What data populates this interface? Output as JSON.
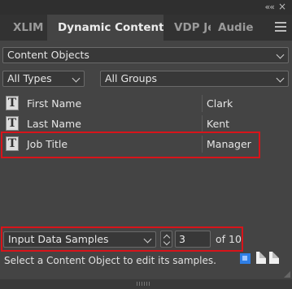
{
  "window": {
    "collapse_glyph": "««",
    "close_glyph": "×"
  },
  "tabs": [
    {
      "label": "XLIM",
      "active": false
    },
    {
      "label": "Dynamic Content",
      "active": true
    },
    {
      "label": "VDP Je",
      "active": false
    },
    {
      "label": "Audie",
      "active": false
    }
  ],
  "content_selector": {
    "value": "Content Objects"
  },
  "type_filter": {
    "value": "All Types"
  },
  "group_filter": {
    "value": "All Groups"
  },
  "content_objects": [
    {
      "icon": "text-frame-icon",
      "glyph": "T",
      "name": "First Name",
      "value": "Clark"
    },
    {
      "icon": "text-frame-icon",
      "glyph": "T",
      "name": "Last Name",
      "value": "Kent"
    },
    {
      "icon": "text-frame-icon",
      "glyph": "T",
      "name": "Job Title",
      "value": "Manager"
    }
  ],
  "samples": {
    "mode": "Input Data Samples",
    "current": "3",
    "of_label": "of 10"
  },
  "status_text": "Select a Content Object to edit its samples.",
  "colors": {
    "highlight": "#d8141a",
    "panel_bg": "#444444",
    "accent_blue": "#2f7fe6"
  }
}
